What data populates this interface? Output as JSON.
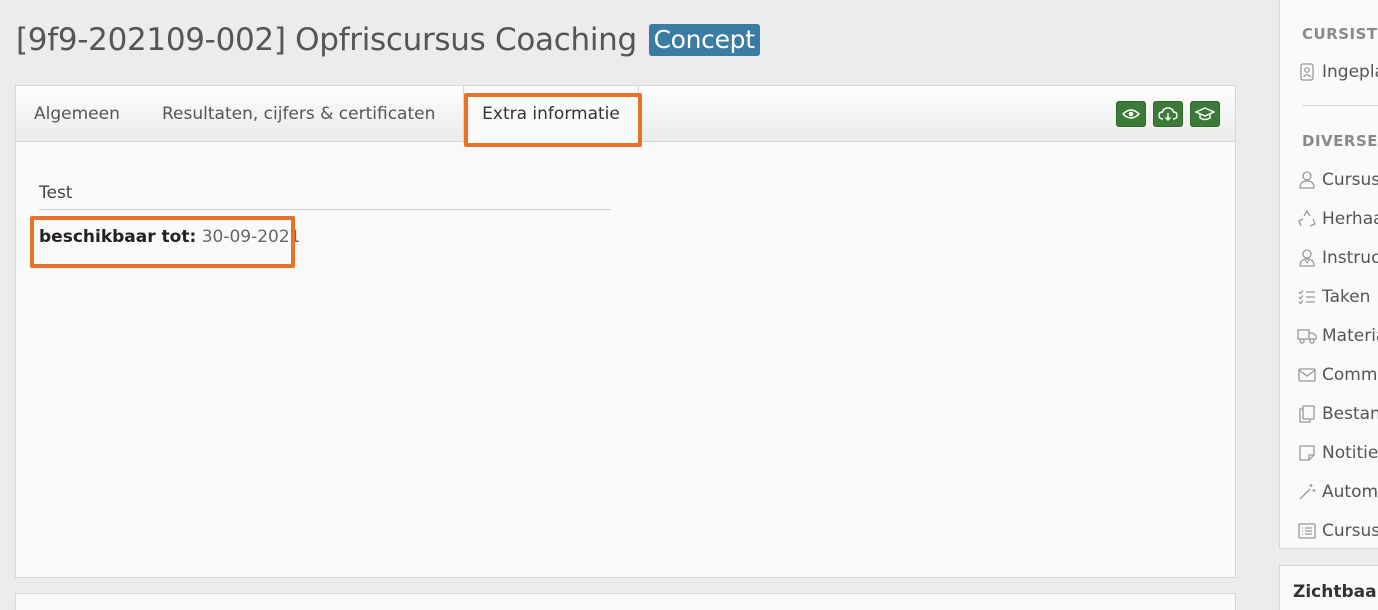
{
  "header": {
    "title": "[9f9-202109-002] Opfriscursus Coaching",
    "status_badge": "Concept"
  },
  "tabs": [
    {
      "label": "Algemeen",
      "active": false
    },
    {
      "label": "Resultaten, cijfers & certificaten",
      "active": false
    },
    {
      "label": "Extra informatie",
      "active": true
    }
  ],
  "tab_actions": [
    {
      "icon": "eye-icon"
    },
    {
      "icon": "cloud-download-icon"
    },
    {
      "icon": "graduation-cap-icon"
    }
  ],
  "content": {
    "section_title": "Test",
    "field_label": "beschikbaar tot:",
    "field_value": "30-09-2021"
  },
  "sidebar": {
    "section1_heading": "CURSISTE",
    "section1_items": [
      {
        "label": "Ingepla",
        "icon": "id-badge-icon"
      }
    ],
    "section2_heading": "DIVERSE",
    "section2_items": [
      {
        "label": "Cursus",
        "icon": "user-icon"
      },
      {
        "label": "Herhaa",
        "icon": "recycle-icon"
      },
      {
        "label": "Instruc",
        "icon": "instructor-icon"
      },
      {
        "label": "Taken",
        "icon": "checklist-icon"
      },
      {
        "label": "Materia",
        "icon": "truck-icon"
      },
      {
        "label": "Comm",
        "icon": "envelope-icon"
      },
      {
        "label": "Bestan",
        "icon": "copy-icon"
      },
      {
        "label": "Notitie",
        "icon": "note-icon"
      },
      {
        "label": "Autom",
        "icon": "magic-wand-icon"
      },
      {
        "label": "Cursus",
        "icon": "list-icon"
      }
    ]
  },
  "side_panel_2": {
    "title": "Zichtbaarl"
  },
  "colors": {
    "badge": "#3b7ca5",
    "action_button": "#3d7a3a",
    "highlight": "#e8722a"
  }
}
